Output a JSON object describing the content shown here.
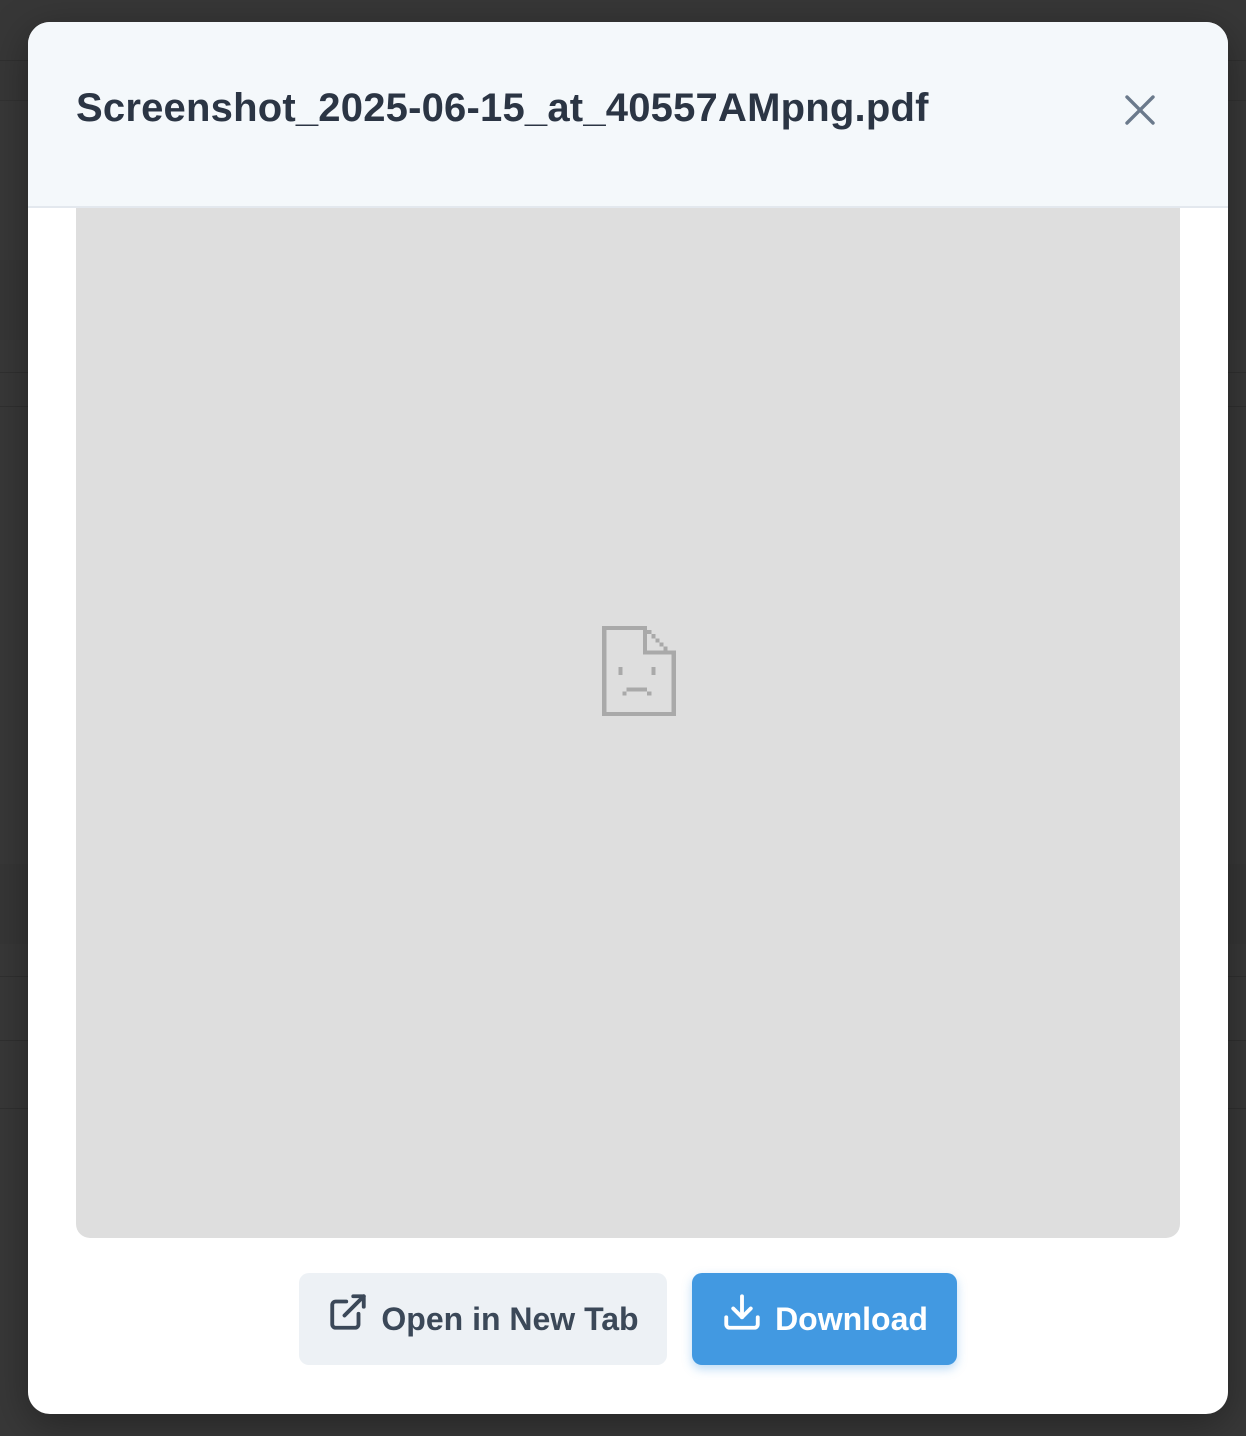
{
  "modal": {
    "title": "Screenshot_2025-06-15_at_40557AMpng.pdf",
    "close_icon": "close-icon",
    "viewer": {
      "state": "failed-to-load",
      "icon": "broken-document-icon"
    },
    "actions": {
      "open_new_tab": {
        "label": "Open in New Tab",
        "icon": "external-link-icon"
      },
      "download": {
        "label": "Download",
        "icon": "download-icon"
      }
    }
  },
  "colors": {
    "header_bg": "#f4f8fb",
    "title": "#2b3544",
    "viewer_bg": "#dedede",
    "secondary_button_bg": "#edf1f5",
    "primary_button_bg": "#4299e1"
  }
}
